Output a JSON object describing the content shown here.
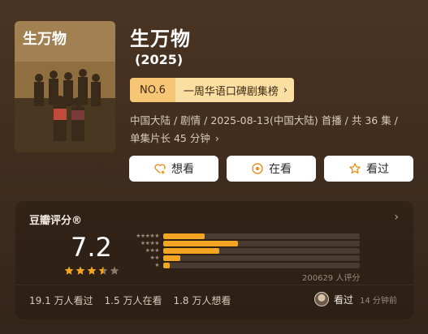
{
  "show": {
    "title": "生万物",
    "year": "(2025)",
    "rank_no": "NO.6",
    "rank_label": "一周华语口碑剧集榜",
    "meta_line1": "中国大陆 / 剧情 / 2025-08-13(中国大陆) 首播 / 共 36 集 /",
    "meta_line2": "单集片长 45 分钟",
    "poster_title": "生万物"
  },
  "actions": {
    "want": "想看",
    "watching": "在看",
    "watched": "看过"
  },
  "rating": {
    "heading": "豆瓣评分®",
    "score": "7.2",
    "stars_value": 3.5,
    "distribution": [
      {
        "stars": "★★★★★",
        "percent": 20.9
      },
      {
        "stars": "★★★★",
        "percent": 38.2
      },
      {
        "stars": "★★★",
        "percent": 28.6
      },
      {
        "stars": "★★",
        "percent": 8.8
      },
      {
        "stars": "★",
        "percent": 3.5
      }
    ],
    "raters": "200629 人评分",
    "stats": [
      "19.1 万人看过",
      "1.5 万人在看",
      "1.8 万人想看"
    ],
    "friend_status": "看过",
    "friend_time": "14 分钟前",
    "accent": "#f4a622"
  }
}
